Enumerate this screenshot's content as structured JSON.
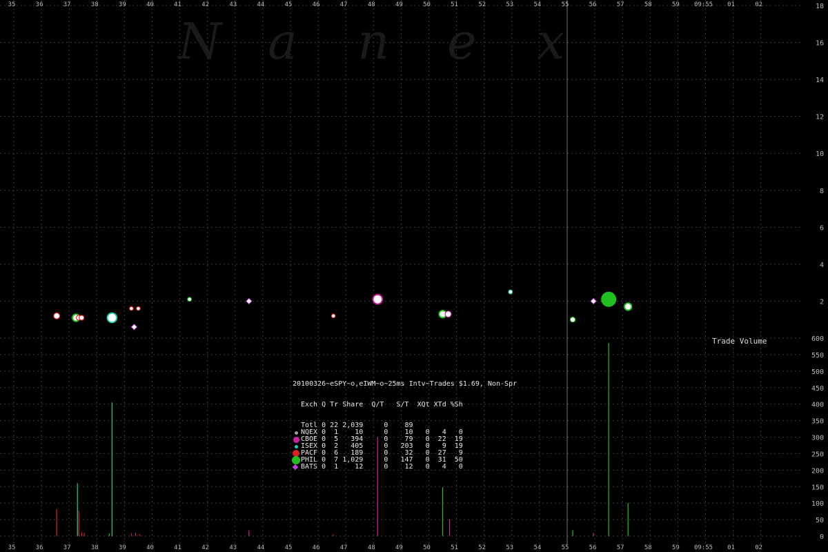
{
  "watermark": [
    "N",
    "a",
    "n",
    "e",
    "x"
  ],
  "colors": {
    "background": "#000000",
    "grid": "#3a3a3a",
    "axis_text": "#bbbbbb",
    "NQEX": "#9a9a9a",
    "CBOE": "#d020a0",
    "ISEX": "#20d0b0",
    "PACF": "#e02020",
    "PHIL": "#20c020",
    "BATS": "#c040e0"
  },
  "chart_data": {
    "type": "scatter",
    "x_tick_labels": [
      "35",
      "36",
      "37",
      "38",
      "39",
      "40",
      "41",
      "42",
      "43",
      "44",
      "45",
      "46",
      "47",
      "48",
      "49",
      "50",
      "51",
      "52",
      "53",
      "54",
      "55",
      "56",
      "57",
      "58",
      "59",
      "09:55",
      "01",
      "02"
    ],
    "price_axis": {
      "ticks": [
        2,
        4,
        6,
        8,
        10,
        12,
        14,
        16,
        18
      ],
      "ylim": [
        0,
        18
      ]
    },
    "volume_axis": {
      "label": "Trade Volume",
      "ticks": [
        0,
        50,
        100,
        150,
        200,
        250,
        300,
        350,
        400,
        450,
        500,
        550,
        600
      ],
      "ylim": [
        0,
        600
      ]
    },
    "minute_marker_x": 55.0,
    "trades": [
      {
        "x": 36.55,
        "price": 1.2,
        "exch": "PACF",
        "size": 3
      },
      {
        "x": 37.25,
        "price": 1.1,
        "exch": "PHIL",
        "size": 4
      },
      {
        "x": 37.35,
        "price": 1.1,
        "exch": "PACF",
        "size": 2
      },
      {
        "x": 37.45,
        "price": 1.1,
        "exch": "PACF",
        "size": 2
      },
      {
        "x": 38.55,
        "price": 1.1,
        "exch": "ISEX",
        "size": 6
      },
      {
        "x": 39.25,
        "price": 1.6,
        "exch": "PACF",
        "size": 1
      },
      {
        "x": 39.35,
        "price": 0.6,
        "exch": "BATS",
        "size": 2
      },
      {
        "x": 39.5,
        "price": 1.6,
        "exch": "PACF",
        "size": 1
      },
      {
        "x": 41.35,
        "price": 2.1,
        "exch": "PHIL",
        "size": 1
      },
      {
        "x": 43.5,
        "price": 2.0,
        "exch": "BATS",
        "size": 2
      },
      {
        "x": 46.55,
        "price": 1.2,
        "exch": "PACF",
        "size": 1
      },
      {
        "x": 48.15,
        "price": 2.1,
        "exch": "CBOE",
        "size": 6
      },
      {
        "x": 50.5,
        "price": 1.3,
        "exch": "PHIL",
        "size": 4
      },
      {
        "x": 50.7,
        "price": 1.3,
        "exch": "CBOE",
        "size": 3
      },
      {
        "x": 52.95,
        "price": 2.5,
        "exch": "ISEX",
        "size": 1
      },
      {
        "x": 55.95,
        "price": 2.0,
        "exch": "BATS",
        "size": 2
      },
      {
        "x": 56.5,
        "price": 2.1,
        "exch": "PHIL",
        "size": 10
      },
      {
        "x": 57.2,
        "price": 1.7,
        "exch": "PHIL",
        "size": 4
      },
      {
        "x": 55.2,
        "price": 1.0,
        "exch": "PHIL",
        "size": 2
      }
    ],
    "volume_bars": [
      {
        "x": 36.55,
        "value": 82,
        "exch": "PACF"
      },
      {
        "x": 37.3,
        "value": 160,
        "exch": "ISEX"
      },
      {
        "x": 37.35,
        "value": 78,
        "exch": "PACF"
      },
      {
        "x": 37.45,
        "value": 12,
        "exch": "PACF"
      },
      {
        "x": 37.55,
        "value": 10,
        "exch": "PACF"
      },
      {
        "x": 38.55,
        "value": 405,
        "exch": "ISEX"
      },
      {
        "x": 38.45,
        "value": 8,
        "exch": "PHIL"
      },
      {
        "x": 39.25,
        "value": 8,
        "exch": "PACF"
      },
      {
        "x": 39.4,
        "value": 10,
        "exch": "CBOE"
      },
      {
        "x": 39.55,
        "value": 6,
        "exch": "PACF"
      },
      {
        "x": 43.5,
        "value": 18,
        "exch": "CBOE"
      },
      {
        "x": 46.55,
        "value": 6,
        "exch": "PACF"
      },
      {
        "x": 48.15,
        "value": 300,
        "exch": "CBOE"
      },
      {
        "x": 50.5,
        "value": 148,
        "exch": "PHIL"
      },
      {
        "x": 50.75,
        "value": 52,
        "exch": "CBOE"
      },
      {
        "x": 55.95,
        "value": 10,
        "exch": "CBOE"
      },
      {
        "x": 56.5,
        "value": 585,
        "exch": "PHIL"
      },
      {
        "x": 57.2,
        "value": 100,
        "exch": "PHIL"
      },
      {
        "x": 55.2,
        "value": 18,
        "exch": "PHIL"
      }
    ]
  },
  "stats": {
    "title": "20100326~eSPY~o,eIWM~o~25ms Intv~Trades $1.69, Non-Spr",
    "header": "Exch Q Tr Share  Q/T   S/T  XQt XTd %Sh",
    "rows": [
      {
        "text": "Totl 0 22 2,039     0    89",
        "marker": "none",
        "exch": ""
      },
      {
        "text": "NQEX 0  1    10     0    10   0   4   0",
        "marker": "dot",
        "exch": "NQEX",
        "size": 5
      },
      {
        "text": "CBOE 0  5   394     0    79   0  22  19",
        "marker": "dot",
        "exch": "CBOE",
        "size": 9
      },
      {
        "text": "ISEX 0  2   405     0   203   0   9  19",
        "marker": "dot",
        "exch": "ISEX",
        "size": 5
      },
      {
        "text": "PACF 0  6   189     0    32   0  27   9",
        "marker": "dot",
        "exch": "PACF",
        "size": 10
      },
      {
        "text": "PHIL 0  7 1,029     0   147   0  31  50",
        "marker": "dot",
        "exch": "PHIL",
        "size": 12
      },
      {
        "text": "BATS 0  1    12     0    12   0   4   0",
        "marker": "diamond",
        "exch": "BATS"
      }
    ]
  }
}
